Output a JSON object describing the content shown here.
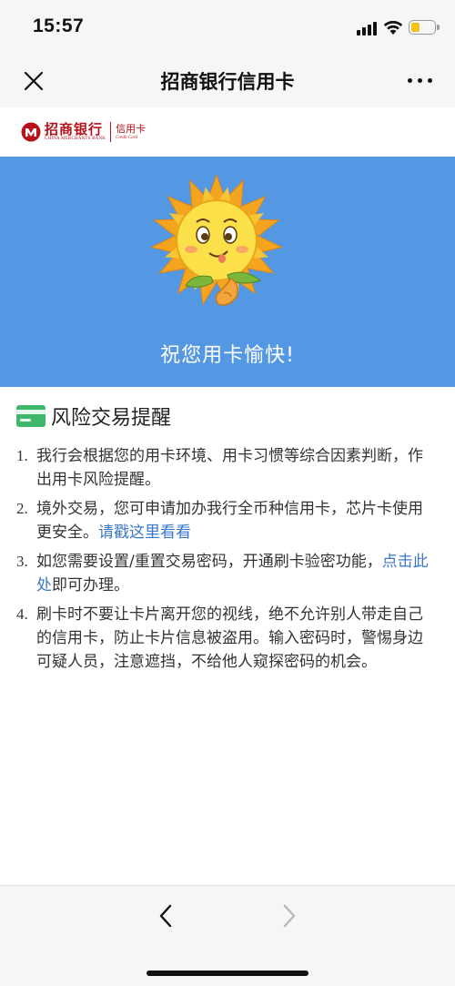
{
  "status_bar": {
    "time": "15:57",
    "icons": [
      "signal-icon",
      "wifi-icon",
      "battery-icon"
    ],
    "battery_level": 0.3
  },
  "nav": {
    "title": "招商银行信用卡",
    "icons": [
      "close-icon",
      "more-icon"
    ]
  },
  "logo": {
    "cn_name": "招商银行",
    "en_name": "CHINA MERCHANTS BANK",
    "card_cn": "信用卡",
    "card_en": "Credit Card"
  },
  "banner": {
    "bg_color": "#5498e4",
    "greeting": "祝您用卡愉快!",
    "icon": "sunflower-mascot"
  },
  "section": {
    "title": "风险交易提醒",
    "icon": "card-icon",
    "icon_color": "#3fb76a"
  },
  "tips": [
    {
      "num": "1.",
      "text": "我行会根据您的用卡环境、用卡习惯等综合因素判断，作出用卡风险提醒。"
    },
    {
      "num": "2.",
      "text": "境外交易，您可申请加办我行全币种信用卡，芯片卡使用更安全。",
      "link": "请戳这里看看"
    },
    {
      "num": "3.",
      "text_before": "如您需要设置/重置交易密码，开通刷卡验密功能，",
      "link": "点击此处",
      "text_after": "即可办理。"
    },
    {
      "num": "4.",
      "text": "刷卡时不要让卡片离开您的视线，绝不允许别人带走自己的信用卡，防止卡片信息被盗用。输入密码时，警惕身边可疑人员，注意遮挡，不给他人窥探密码的机会。"
    }
  ],
  "toolbar": {
    "icons": [
      "back-chevron-icon",
      "forward-chevron-icon"
    ],
    "forward_enabled": false
  },
  "colors": {
    "link": "#3a78c7",
    "brand_red": "#b5121b"
  }
}
